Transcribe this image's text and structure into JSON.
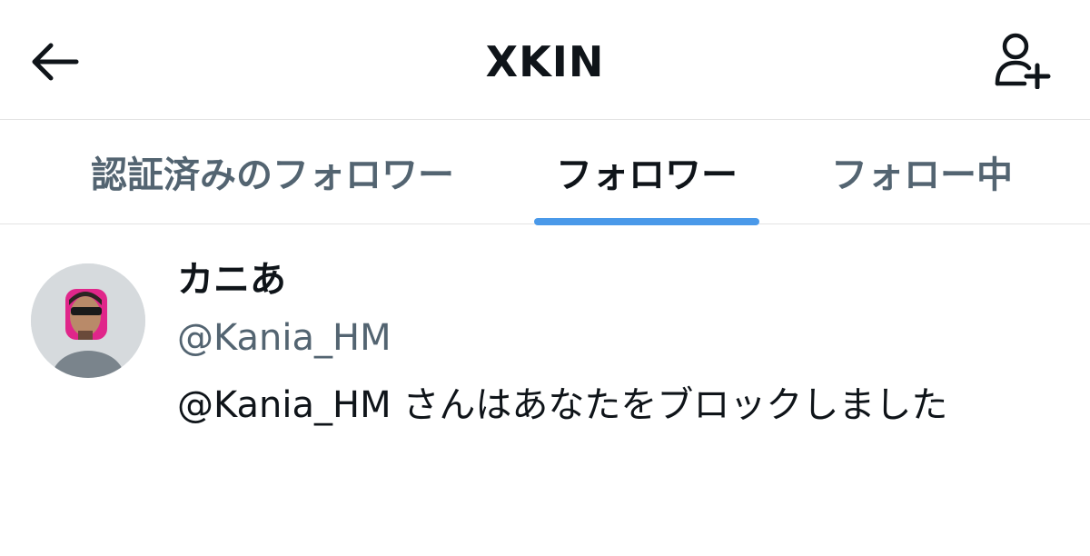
{
  "header": {
    "title": "XKIN",
    "back_icon": "arrow-left-icon",
    "add_user_icon": "person-add-icon"
  },
  "tabs": [
    {
      "label": "認証済みのフォロワー",
      "active": false
    },
    {
      "label": "フォロワー",
      "active": true
    },
    {
      "label": "フォロー中",
      "active": false
    }
  ],
  "colors": {
    "accent": "#4a99e9",
    "text_primary": "#0f1419",
    "text_secondary": "#536471",
    "divider": "#e3e3e3"
  },
  "user": {
    "display_name": "カニあ",
    "handle": "@Kania_HM",
    "status": "@Kania_HM さんはあなたをブロックしました"
  }
}
